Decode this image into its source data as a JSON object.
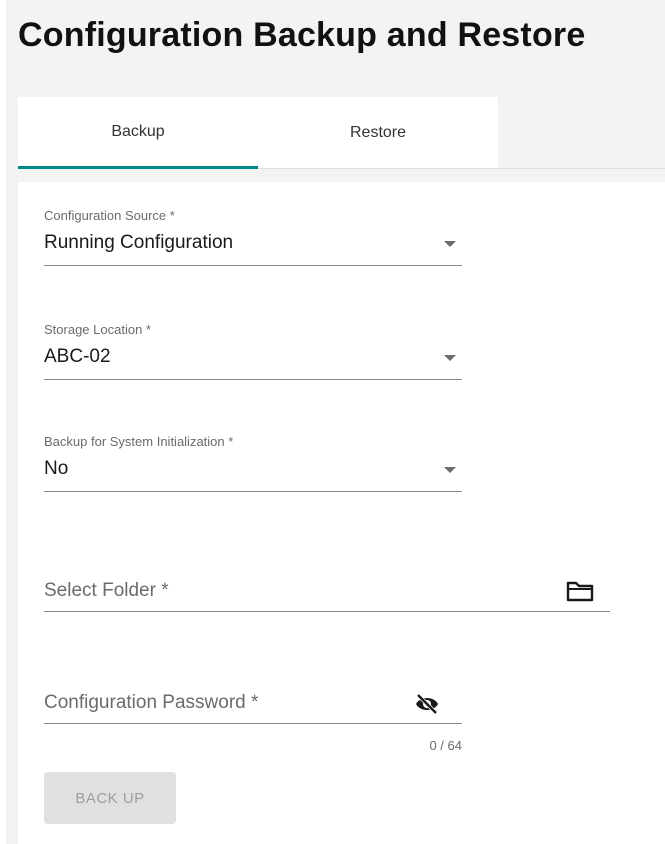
{
  "page": {
    "title": "Configuration Backup and Restore"
  },
  "tabs": [
    {
      "label": "Backup",
      "active": true
    },
    {
      "label": "Restore",
      "active": false
    }
  ],
  "form": {
    "config_source": {
      "label": "Configuration Source *",
      "value": "Running Configuration"
    },
    "storage_location": {
      "label": "Storage Location *",
      "value": "ABC-02"
    },
    "system_init": {
      "label": "Backup for System Initialization *",
      "value": "No"
    },
    "select_folder": {
      "placeholder": "Select Folder *",
      "icon": "folder-icon"
    },
    "password": {
      "placeholder": "Configuration Password *",
      "counter": "0 / 64",
      "icon": "eye-off-icon"
    }
  },
  "actions": {
    "backup_label": "BACK UP",
    "backup_disabled": true
  },
  "colors": {
    "accent": "#008787",
    "disabled_bg": "#e0e0e0",
    "disabled_text": "#9e9e9e"
  }
}
